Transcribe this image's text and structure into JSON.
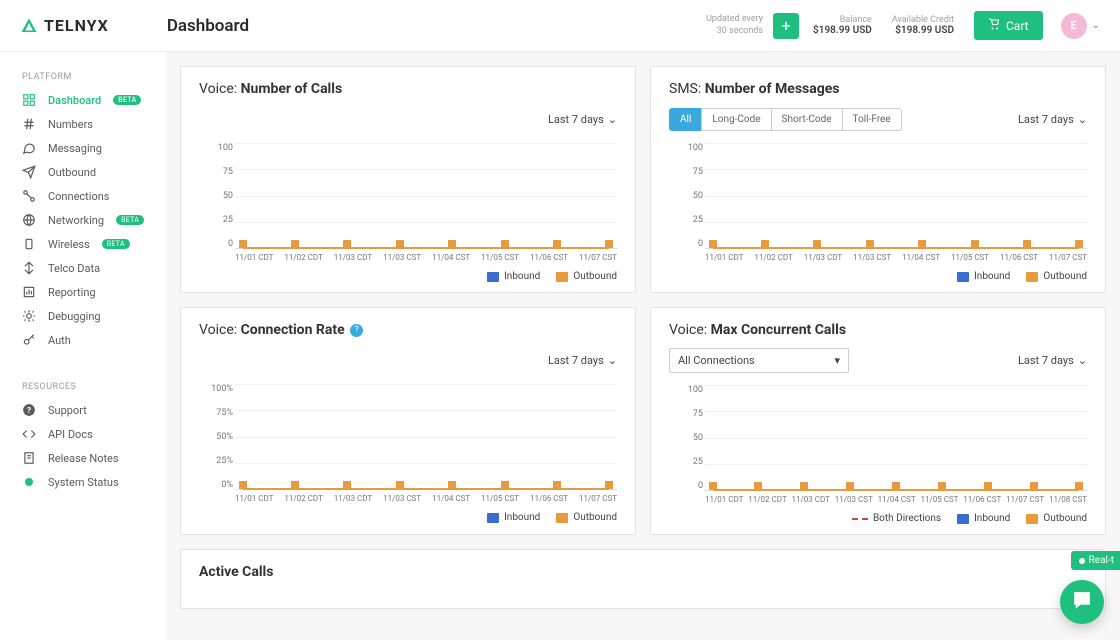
{
  "brand": "TELNYX",
  "page_title": "Dashboard",
  "updated": {
    "line1": "Updated every",
    "line2": "30 seconds"
  },
  "balance": {
    "label": "Balance",
    "value": "$198.99 USD"
  },
  "credit": {
    "label": "Available Credit",
    "value": "$198.99 USD"
  },
  "cart_label": "Cart",
  "avatar_initial": "E",
  "sidebar": {
    "platform_heading": "PLATFORM",
    "resources_heading": "RESOURCES",
    "platform": [
      {
        "label": "Dashboard",
        "badge": "BETA"
      },
      {
        "label": "Numbers"
      },
      {
        "label": "Messaging"
      },
      {
        "label": "Outbound"
      },
      {
        "label": "Connections"
      },
      {
        "label": "Networking",
        "badge": "BETA"
      },
      {
        "label": "Wireless",
        "badge": "BETA"
      },
      {
        "label": "Telco Data"
      },
      {
        "label": "Reporting"
      },
      {
        "label": "Debugging"
      },
      {
        "label": "Auth"
      }
    ],
    "resources": [
      {
        "label": "Support"
      },
      {
        "label": "API Docs"
      },
      {
        "label": "Release Notes"
      },
      {
        "label": "System Status"
      }
    ]
  },
  "cards": {
    "voice_calls": {
      "prefix": "Voice:",
      "suffix": "Number of Calls",
      "range": "Last 7 days"
    },
    "sms": {
      "prefix": "SMS:",
      "suffix": "Number of Messages",
      "range": "Last 7 days",
      "tabs": [
        "All",
        "Long-Code",
        "Short-Code",
        "Toll-Free"
      ]
    },
    "conn_rate": {
      "prefix": "Voice:",
      "suffix": "Connection Rate",
      "range": "Last 7 days"
    },
    "max_concurrent": {
      "prefix": "Voice:",
      "suffix": "Max Concurrent Calls",
      "range": "Last 7 days",
      "dropdown": "All Connections"
    },
    "active_calls": {
      "title": "Active Calls"
    }
  },
  "legend": {
    "inbound": "Inbound",
    "outbound": "Outbound",
    "both": "Both Directions"
  },
  "realtime": "Real-t",
  "chart_data": [
    {
      "card": "voice_calls",
      "type": "line",
      "xlabel": "",
      "ylabel": "",
      "ylim": [
        0,
        100
      ],
      "y_ticks": [
        "100",
        "75",
        "50",
        "25",
        "0"
      ],
      "categories": [
        "11/01 CDT",
        "11/02 CDT",
        "11/03 CDT",
        "11/03 CST",
        "11/04 CST",
        "11/05 CST",
        "11/06 CST",
        "11/07 CST"
      ],
      "series": [
        {
          "name": "Inbound",
          "values": [
            0,
            0,
            0,
            0,
            0,
            0,
            0,
            0
          ]
        },
        {
          "name": "Outbound",
          "values": [
            0,
            0,
            0,
            0,
            0,
            0,
            0,
            0
          ]
        }
      ]
    },
    {
      "card": "sms",
      "type": "line",
      "xlabel": "",
      "ylabel": "",
      "ylim": [
        0,
        100
      ],
      "y_ticks": [
        "100",
        "75",
        "50",
        "25",
        "0"
      ],
      "categories": [
        "11/01 CDT",
        "11/02 CDT",
        "11/03 CDT",
        "11/03 CST",
        "11/04 CST",
        "11/05 CST",
        "11/06 CST",
        "11/07 CST"
      ],
      "series": [
        {
          "name": "Inbound",
          "values": [
            0,
            0,
            0,
            0,
            0,
            0,
            0,
            0
          ]
        },
        {
          "name": "Outbound",
          "values": [
            0,
            0,
            0,
            0,
            0,
            0,
            0,
            0
          ]
        }
      ]
    },
    {
      "card": "conn_rate",
      "type": "line",
      "xlabel": "",
      "ylabel": "",
      "ylim": [
        0,
        100
      ],
      "y_unit": "%",
      "y_ticks": [
        "100%",
        "75%",
        "50%",
        "25%",
        "0%"
      ],
      "categories": [
        "11/01 CDT",
        "11/02 CDT",
        "11/03 CDT",
        "11/03 CST",
        "11/04 CST",
        "11/05 CST",
        "11/06 CST",
        "11/07 CST"
      ],
      "series": [
        {
          "name": "Inbound",
          "values": [
            0,
            0,
            0,
            0,
            0,
            0,
            0,
            0
          ]
        },
        {
          "name": "Outbound",
          "values": [
            0,
            0,
            0,
            0,
            0,
            0,
            0,
            0
          ]
        }
      ]
    },
    {
      "card": "max_concurrent",
      "type": "line",
      "xlabel": "",
      "ylabel": "",
      "ylim": [
        0,
        100
      ],
      "y_ticks": [
        "100",
        "75",
        "50",
        "25",
        "0"
      ],
      "categories": [
        "11/01 CDT",
        "11/02 CDT",
        "11/03 CDT",
        "11/03 CST",
        "11/04 CST",
        "11/05 CST",
        "11/06 CST",
        "11/07 CST",
        "11/08 CST"
      ],
      "series": [
        {
          "name": "Inbound",
          "values": [
            0,
            0,
            0,
            0,
            0,
            0,
            0,
            0,
            0
          ]
        },
        {
          "name": "Outbound",
          "values": [
            0,
            0,
            0,
            0,
            0,
            0,
            0,
            0,
            0
          ]
        }
      ]
    }
  ]
}
